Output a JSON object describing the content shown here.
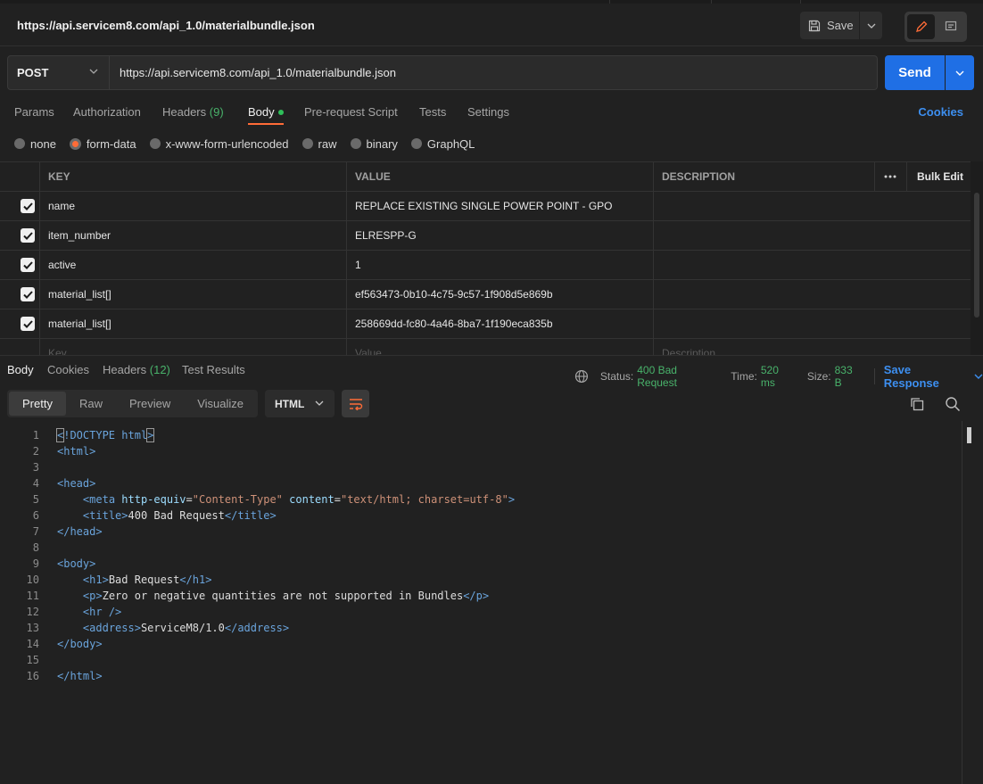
{
  "header": {
    "title": "https://api.servicem8.com/api_1.0/materialbundle.json",
    "save_label": "Save"
  },
  "request": {
    "method": "POST",
    "url": "https://api.servicem8.com/api_1.0/materialbundle.json",
    "send_label": "Send"
  },
  "req_tabs": {
    "params": "Params",
    "authorization": "Authorization",
    "headers": "Headers",
    "headers_count": "(9)",
    "body": "Body",
    "prerequest": "Pre-request Script",
    "tests": "Tests",
    "settings": "Settings",
    "cookies": "Cookies"
  },
  "body_types": {
    "none": "none",
    "form_data": "form-data",
    "urlencoded": "x-www-form-urlencoded",
    "raw": "raw",
    "binary": "binary",
    "graphql": "GraphQL",
    "selected": "form-data"
  },
  "table": {
    "headers": {
      "key": "KEY",
      "value": "VALUE",
      "description": "DESCRIPTION",
      "bulk_edit": "Bulk Edit"
    },
    "rows": [
      {
        "key": "name",
        "value": "REPLACE EXISTING SINGLE POWER POINT - GPO",
        "description": ""
      },
      {
        "key": "item_number",
        "value": "ELRESPP-G",
        "description": ""
      },
      {
        "key": "active",
        "value": "1",
        "description": ""
      },
      {
        "key": "material_list[]",
        "value": "ef563473-0b10-4c75-9c57-1f908d5e869b",
        "description": ""
      },
      {
        "key": "material_list[]",
        "value": "258669dd-fc80-4a46-8ba7-1f190eca835b",
        "description": ""
      }
    ],
    "placeholders": {
      "key": "Key",
      "value": "Value",
      "description": "Description"
    }
  },
  "response": {
    "tabs": {
      "body": "Body",
      "cookies": "Cookies",
      "headers": "Headers",
      "headers_count": "(12)",
      "test_results": "Test Results"
    },
    "status_label": "Status:",
    "status_value": "400 Bad Request",
    "time_label": "Time:",
    "time_value": "520 ms",
    "size_label": "Size:",
    "size_value": "833 B",
    "save_response": "Save Response"
  },
  "viewer": {
    "modes": {
      "pretty": "Pretty",
      "raw": "Raw",
      "preview": "Preview",
      "visualize": "Visualize"
    },
    "format": "HTML"
  },
  "code": {
    "line_numbers": [
      "1",
      "2",
      "3",
      "4",
      "5",
      "6",
      "7",
      "8",
      "9",
      "10",
      "11",
      "12",
      "13",
      "14",
      "15",
      "16"
    ],
    "doctype": "!DOCTYPE",
    "html_word": "html",
    "head_word": "head",
    "meta_word": "meta",
    "attr_http_equiv": "http-equiv",
    "val_content_type": "\"Content-Type\"",
    "attr_content": "content",
    "val_content": "\"text/html; charset=utf-8\"",
    "title_word": "title",
    "title_text": "400 Bad Request",
    "body_word": "body",
    "h1_word": "h1",
    "h1_text": "Bad Request",
    "p_word": "p",
    "p_text": "Zero or negative quantities are not supported in Bundles",
    "hr_word": "hr",
    "address_word": "address",
    "address_text": "ServiceM8/1.0"
  },
  "colors": {
    "accent_orange": "#ff6c37",
    "send_blue": "#1f6fe5",
    "link_blue": "#3d8ff0",
    "status_green": "#49b36b"
  }
}
